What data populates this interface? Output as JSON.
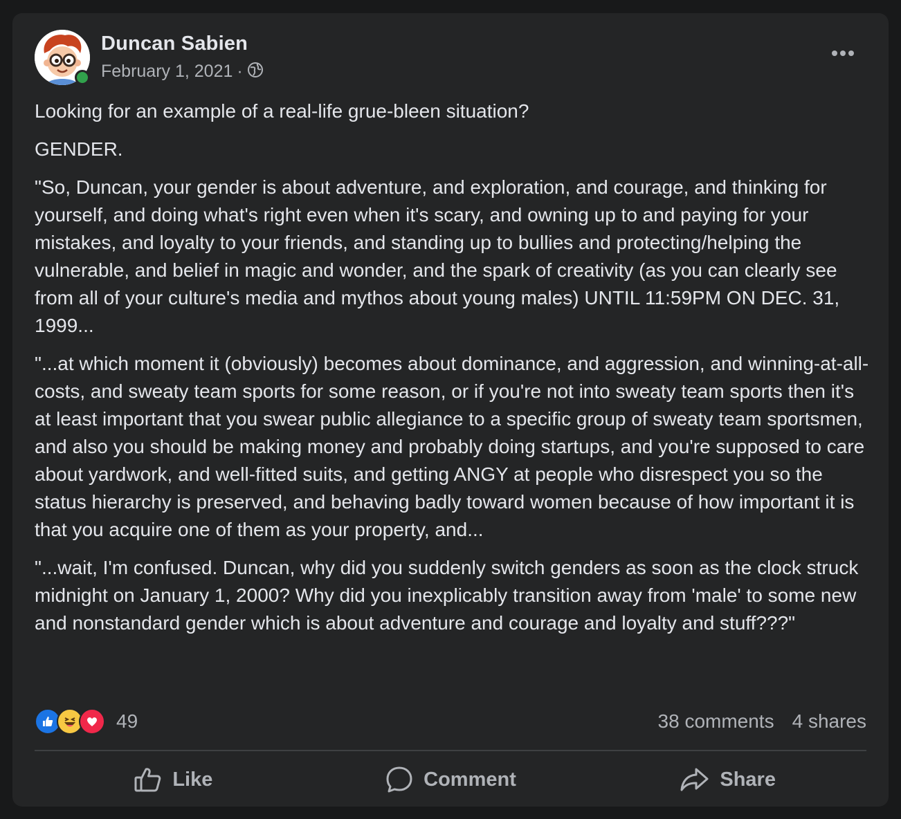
{
  "post": {
    "author": "Duncan Sabien",
    "date": "February 1, 2021",
    "separator": "·",
    "audience_icon": "globe-icon",
    "more_icon": "ellipsis-icon",
    "online": true
  },
  "content": {
    "paragraphs": [
      "Looking for an example of a real-life grue-bleen situation?",
      "GENDER.",
      "\"So, Duncan, your gender is about adventure, and exploration, and courage, and thinking for yourself, and doing what's right even when it's scary, and owning up to and paying for your mistakes, and loyalty to your friends, and standing up to bullies and protecting/helping the vulnerable, and belief in magic and wonder, and the spark of creativity (as you can clearly see from all of your culture's media and mythos about young males) UNTIL 11:59PM ON DEC. 31, 1999...",
      "\"...at which moment it (obviously) becomes about dominance, and aggression, and winning-at-all-costs, and sweaty team sports for some reason, or if you're not into sweaty team sports then it's at least important that you swear public allegiance to a specific group of sweaty team sportsmen, and also you should be making money and probably doing startups, and you're supposed to care about yardwork, and well-fitted suits, and getting ANGY at people who disrespect you so the status hierarchy is preserved, and behaving badly toward women because of how important it is that you acquire one of them as your property, and...",
      "\"...wait, I'm confused.  Duncan, why did you suddenly switch genders as soon as the clock struck midnight on January 1, 2000?  Why did you inexplicably transition away from 'male' to some new and nonstandard gender which is about adventure and courage and loyalty and stuff???\""
    ]
  },
  "stats": {
    "reactions": [
      "like-icon",
      "haha-icon",
      "love-icon"
    ],
    "reaction_count": "49",
    "comments": "38 comments",
    "shares": "4 shares"
  },
  "actions": {
    "like_label": "Like",
    "comment_label": "Comment",
    "share_label": "Share"
  },
  "colors": {
    "background": "#18191a",
    "card": "#242526",
    "text_primary": "#e4e6eb",
    "text_secondary": "#b0b3b8",
    "like_blue": "#1b74e4",
    "love_red": "#f0284a",
    "haha_yellow": "#f7c843",
    "online_green": "#31a24c"
  }
}
